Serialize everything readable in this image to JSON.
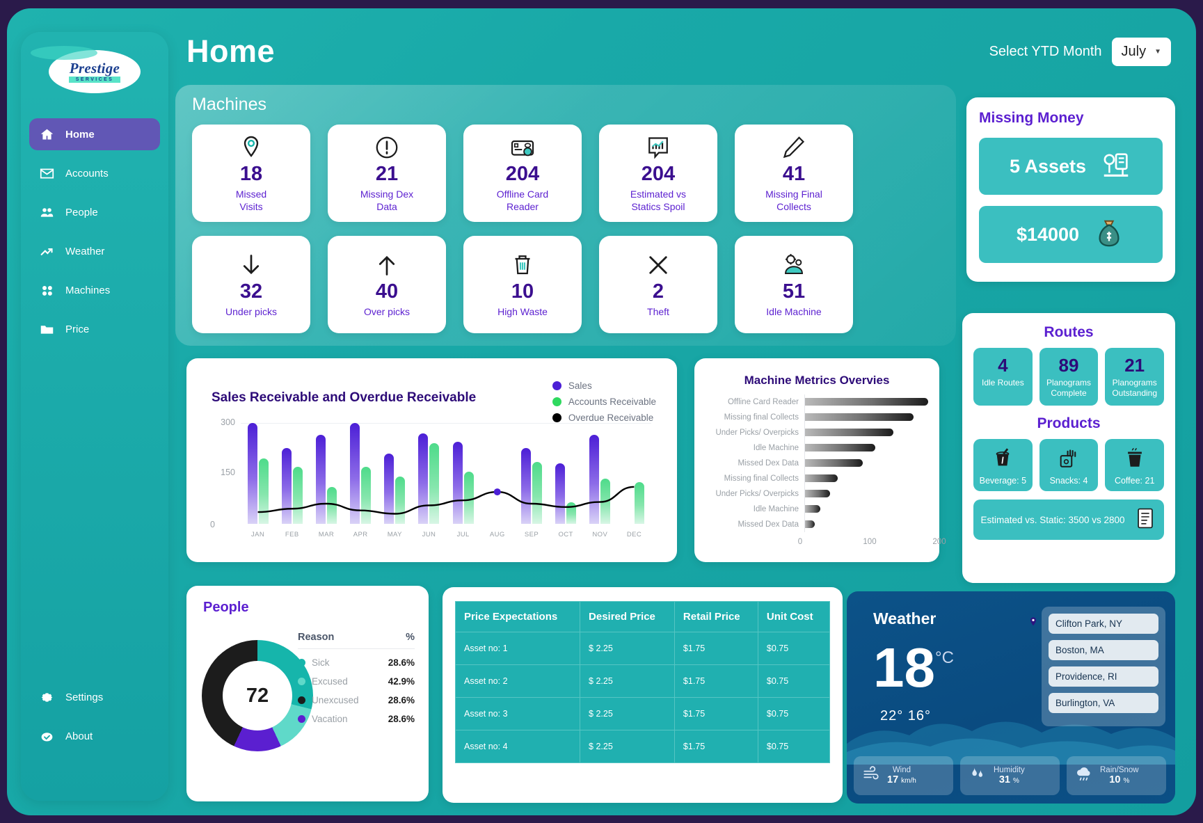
{
  "brand": {
    "name": "Prestige",
    "sub": "SERVICES"
  },
  "sidebar": {
    "items": [
      {
        "label": "Home",
        "icon": "home-icon"
      },
      {
        "label": "Accounts",
        "icon": "envelope-icon"
      },
      {
        "label": "People",
        "icon": "people-icon"
      },
      {
        "label": "Weather",
        "icon": "trend-up-icon"
      },
      {
        "label": "Machines",
        "icon": "grid-dots-icon"
      },
      {
        "label": "Price",
        "icon": "folder-icon"
      }
    ],
    "bottom": [
      {
        "label": "Settings",
        "icon": "gear-icon"
      },
      {
        "label": "About",
        "icon": "check-badge-icon"
      }
    ]
  },
  "header": {
    "title": "Home",
    "ytd_label": "Select YTD Month",
    "ytd_value": "July"
  },
  "machines": {
    "title": "Machines",
    "cards": [
      {
        "value": "18",
        "label": "Missed\nVisits",
        "icon": "map-pin-icon"
      },
      {
        "value": "21",
        "label": "Missing Dex\nData",
        "icon": "alert-circle-icon"
      },
      {
        "value": "204",
        "label": "Offline Card\nReader",
        "icon": "card-reader-icon"
      },
      {
        "value": "204",
        "label": "Estimated vs\nStatics Spoil",
        "icon": "chart-callout-icon"
      },
      {
        "value": "41",
        "label": "Missing Final\nCollects",
        "icon": "pen-icon"
      },
      {
        "value": "32",
        "label": "Under picks",
        "icon": "arrow-down-icon"
      },
      {
        "value": "40",
        "label": "Over picks",
        "icon": "arrow-up-icon"
      },
      {
        "value": "10",
        "label": "High Waste",
        "icon": "trash-icon"
      },
      {
        "value": "2",
        "label": "Theft",
        "icon": "x-cross-icon"
      },
      {
        "value": "51",
        "label": "Idle Machine",
        "icon": "gear-machine-icon"
      }
    ]
  },
  "missing_money": {
    "title": "Missing Money",
    "assets": "5 Assets",
    "amount": "$14000",
    "assets_icon": "money-assets-icon",
    "amount_icon": "money-bag-icon"
  },
  "routes": {
    "title": "Routes",
    "cells": [
      {
        "num": "4",
        "label": "Idle Routes"
      },
      {
        "num": "89",
        "label": "Planograms\nComplete"
      },
      {
        "num": "21",
        "label": "Planograms\nOutstanding"
      }
    ]
  },
  "products": {
    "title": "Products",
    "cells": [
      {
        "label": "Beverage: 5",
        "icon": "beverage-cup-icon"
      },
      {
        "label": "Snacks: 4",
        "icon": "snack-bag-icon"
      },
      {
        "label": "Coffee: 21",
        "icon": "coffee-cup-icon"
      }
    ],
    "estimated": "Estimated vs. Static: 3500 vs 2800",
    "estimated_icon": "document-icon"
  },
  "chart_data": [
    {
      "type": "bar",
      "title": "Sales Receivable and Overdue Receivable",
      "categories": [
        "JAN",
        "FEB",
        "MAR",
        "APR",
        "MAY",
        "JUN",
        "JUL",
        "AUG",
        "SEP",
        "OCT",
        "NOV",
        "DEC"
      ],
      "series": [
        {
          "name": "Sales",
          "color": "#4c1fd6",
          "values": [
            300,
            225,
            265,
            300,
            210,
            270,
            245,
            0,
            225,
            180,
            265,
            0
          ]
        },
        {
          "name": "Accounts Receivable",
          "color": "#4edb8a",
          "values": [
            195,
            170,
            110,
            170,
            140,
            240,
            155,
            0,
            185,
            65,
            135,
            125
          ]
        },
        {
          "name": "Overdue Receivable",
          "color": "#000000",
          "values": [
            35,
            45,
            60,
            40,
            30,
            55,
            70,
            95,
            60,
            50,
            65,
            110
          ]
        }
      ],
      "ylim": [
        0,
        300
      ],
      "yticks": [
        "0",
        "150",
        "300"
      ],
      "xlabel": "",
      "ylabel": "",
      "grid": true,
      "legend_position": "top-right"
    },
    {
      "type": "bar",
      "orientation": "horizontal",
      "title": "Machine Metrics Overvies",
      "categories": [
        "Offline Card Reader",
        "Missing final Collects",
        "Under Picks/ Overpicks",
        "Idle Machine",
        "Missed Dex Data",
        "Missing final Collects",
        "Under Picks/ Overpicks",
        "Idle Machine",
        "Missed Dex Data"
      ],
      "values": [
        196,
        172,
        140,
        112,
        92,
        52,
        40,
        24,
        16
      ],
      "xlim": [
        0,
        200
      ],
      "xticks": [
        "0",
        "100",
        "200"
      ],
      "grid": false
    },
    {
      "type": "pie",
      "title": "People",
      "center_value": "72",
      "col_reason": "Reason",
      "col_pct": "%",
      "labels": [
        "Sick",
        "Excused",
        "Unexcused",
        "Vacation"
      ],
      "values": [
        28.6,
        42.9,
        28.6,
        28.6
      ],
      "display_values": [
        "28.6%",
        "42.9%",
        "28.6%",
        "28.6%"
      ],
      "colors": [
        "#16b5ab",
        "#5fd9c9",
        "#1c1c1c",
        "#5b1fd0"
      ]
    }
  ],
  "price_table": {
    "headers": [
      "Price Expectations",
      "Desired Price",
      "Retail Price",
      "Unit Cost"
    ],
    "rows": [
      [
        "Asset no: 1",
        "$ 2.25",
        "$1.75",
        "$0.75"
      ],
      [
        "Asset no: 2",
        "$ 2.25",
        "$1.75",
        "$0.75"
      ],
      [
        "Asset no: 3",
        "$ 2.25",
        "$1.75",
        "$0.75"
      ],
      [
        "Asset no: 4",
        "$ 2.25",
        "$1.75",
        "$0.75"
      ]
    ]
  },
  "weather": {
    "title": "Weather",
    "temp": "18",
    "unit": "°C",
    "high_low": "22° 16°",
    "cities": [
      "Clifton Park, NY",
      "Boston, MA",
      "Providence, RI",
      "Burlington, VA"
    ],
    "stats": [
      {
        "name": "Wind",
        "value": "17",
        "unit": "km/h",
        "icon": "wind-icon"
      },
      {
        "name": "Humidity",
        "value": "31",
        "unit": "%",
        "icon": "humidity-icon"
      },
      {
        "name": "Rain/Snow",
        "value": "10",
        "unit": "%",
        "icon": "rain-icon"
      }
    ]
  }
}
